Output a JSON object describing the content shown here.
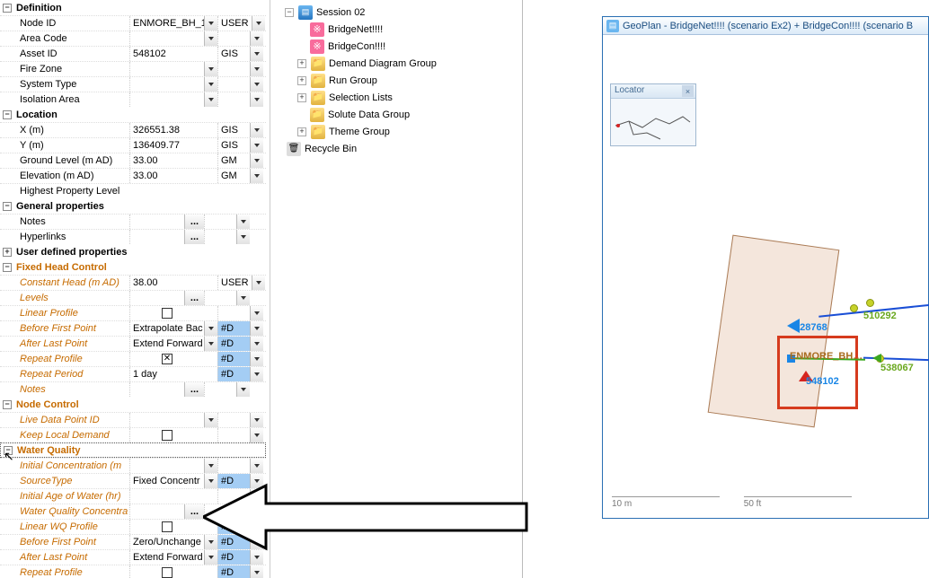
{
  "props": {
    "definition": {
      "header": "Definition",
      "node_id_label": "Node ID",
      "node_id": "ENMORE_BH_1",
      "node_id_unit": "USER",
      "area_code_label": "Area Code",
      "asset_id_label": "Asset ID",
      "asset_id": "548102",
      "asset_id_unit": "GIS",
      "fire_zone_label": "Fire Zone",
      "system_type_label": "System Type",
      "isolation_area_label": "Isolation Area"
    },
    "location": {
      "header": "Location",
      "x_label": "X (m)",
      "x": "326551.38",
      "x_unit": "GIS",
      "y_label": "Y (m)",
      "y": "136409.77",
      "y_unit": "GIS",
      "ground_label": "Ground Level (m AD)",
      "ground": "33.00",
      "ground_unit": "GM",
      "elev_label": "Elevation (m AD)",
      "elev": "33.00",
      "elev_unit": "GM",
      "hpl_label": "Highest Property Level"
    },
    "general": {
      "header": "General properties",
      "notes_label": "Notes",
      "hyperlinks_label": "Hyperlinks"
    },
    "udp": {
      "header": "User defined properties"
    },
    "fhc": {
      "header": "Fixed Head Control",
      "const_head_label": "Constant Head (m AD)",
      "const_head": "38.00",
      "const_head_unit": "USER",
      "levels_label": "Levels",
      "linear_label": "Linear Profile",
      "bfp_label": "Before First Point",
      "bfp": "Extrapolate Bac",
      "bfp_unit": "#D",
      "alp_label": "After Last Point",
      "alp": "Extend Forward",
      "alp_unit": "#D",
      "repeat_profile_label": "Repeat Profile",
      "repeat_profile_checked": true,
      "repeat_profile_unit": "#D",
      "repeat_period_label": "Repeat Period",
      "repeat_period": "1 day",
      "repeat_period_unit": "#D",
      "notes_label": "Notes"
    },
    "node_ctrl": {
      "header": "Node Control",
      "ldp_label": "Live Data Point ID",
      "kld_label": "Keep Local Demand"
    },
    "wq": {
      "header": "Water Quality",
      "init_conc_label": "Initial  Concentration (m",
      "src_label": "SourceType",
      "src": "Fixed Concentr",
      "src_unit": "#D",
      "iaow_label": "Initial Age of Water (hr)",
      "wqc_label": "Water Quality Concentra",
      "linwq_label": "Linear WQ Profile",
      "linwq_unit": "#D",
      "bfp_label": "Before First Point",
      "bfp": "Zero/Unchange",
      "bfp_unit": "#D",
      "alp_label": "After Last Point",
      "alp": "Extend Forward",
      "alp_unit": "#D",
      "rp_label": "Repeat Profile",
      "rp_unit": "#D"
    }
  },
  "tree": {
    "session": "Session 02",
    "net1": "BridgeNet!!!!",
    "net2": "BridgeCon!!!!",
    "f1": "Demand Diagram Group",
    "f2": "Run Group",
    "f3": "Selection Lists",
    "f4": "Solute Data Group",
    "f5": "Theme Group",
    "bin": "Recycle Bin"
  },
  "geoplan": {
    "title": "GeoPlan - BridgeNet!!!! (scenario Ex2)  + BridgeCon!!!! (scenario B",
    "locator": "Locator",
    "scale_left": "10 m",
    "scale_right": "50 ft",
    "lbl_528768": "528768",
    "lbl_510292": "510292",
    "lbl_538067": "538067",
    "lbl_enmore": "ENMORE_BH…",
    "lbl_548102": "548102"
  },
  "ellipsis": "..."
}
